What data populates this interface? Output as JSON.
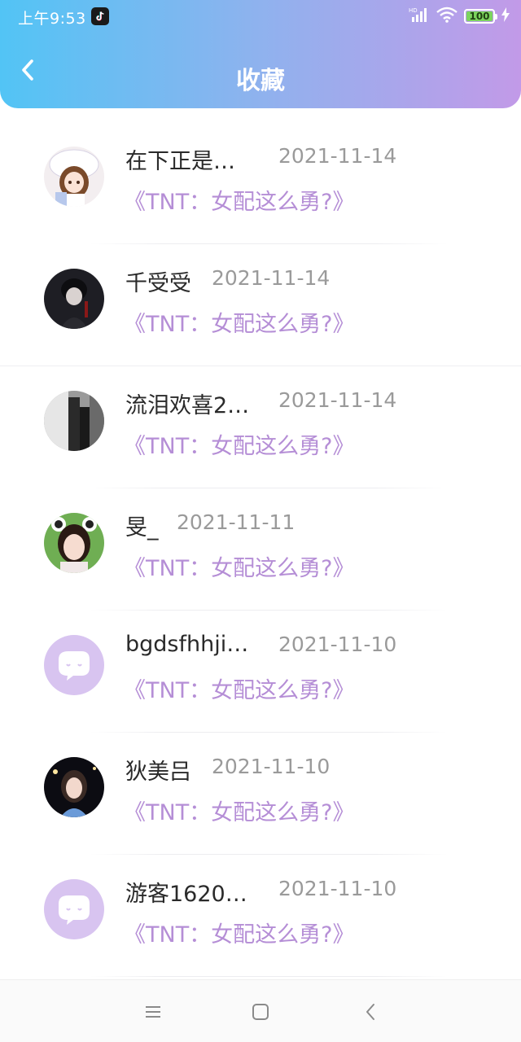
{
  "status": {
    "time": "上午9:53",
    "battery": "100",
    "signal_label": "HD"
  },
  "header": {
    "title": "收藏"
  },
  "items": [
    {
      "name": "在下正是…",
      "date": "2021-11-14",
      "book": "《TNT：女配这么勇?》"
    },
    {
      "name": "千受受",
      "date": "2021-11-14",
      "book": "《TNT：女配这么勇?》"
    },
    {
      "name": "流泪欢喜2…",
      "date": "2021-11-14",
      "book": "《TNT：女配这么勇?》"
    },
    {
      "name": "旻_",
      "date": "2021-11-11",
      "book": "《TNT：女配这么勇?》"
    },
    {
      "name": "bgdsfhhji…",
      "date": "2021-11-10",
      "book": "《TNT：女配这么勇?》"
    },
    {
      "name": "狄美吕",
      "date": "2021-11-10",
      "book": "《TNT：女配这么勇?》"
    },
    {
      "name": "游客1620…",
      "date": "2021-11-10",
      "book": "《TNT：女配这么勇?》"
    }
  ],
  "colors": {
    "accent": "#b58ed6",
    "gradient_start": "#52c4f5",
    "gradient_end": "#c29ae8"
  }
}
